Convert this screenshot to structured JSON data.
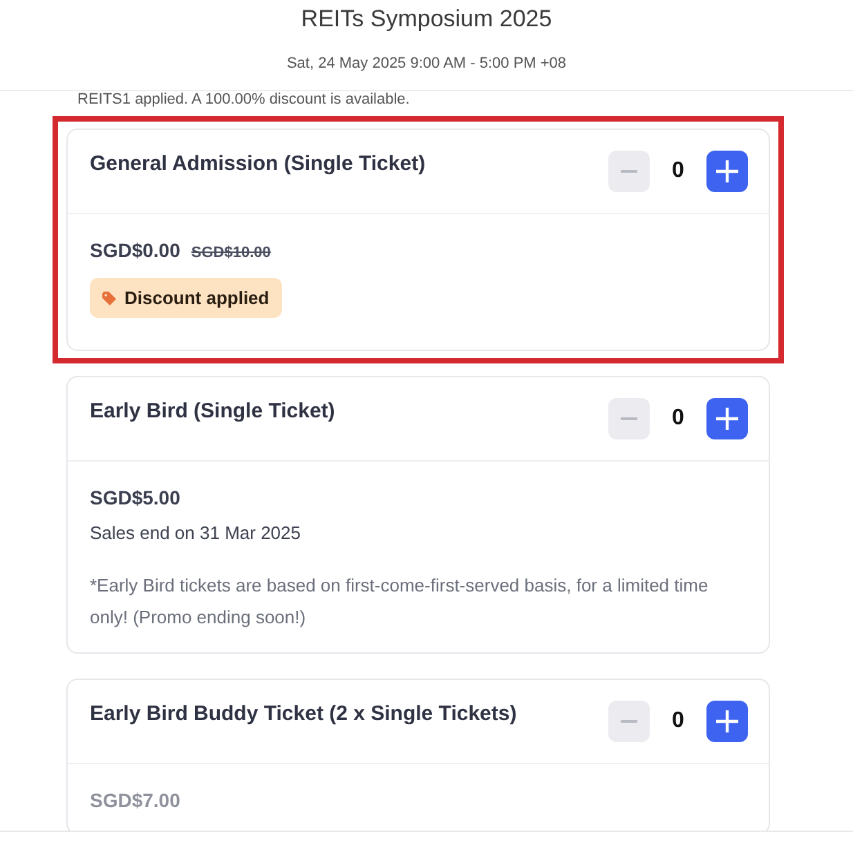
{
  "header": {
    "title": "REITs Symposium 2025",
    "datetime": "Sat, 24 May 2025 9:00 AM - 5:00 PM +08"
  },
  "promo_notice": "REITS1 applied. A 100.00% discount is available.",
  "tickets": [
    {
      "name": "General Admission (Single Ticket)",
      "highlighted": true,
      "minus_disabled": true,
      "quantity": "0",
      "price": "SGD$0.00",
      "original_price": "SGD$10.00",
      "muted": false,
      "badge": "Discount applied"
    },
    {
      "name": "Early Bird (Single Ticket)",
      "highlighted": false,
      "minus_disabled": true,
      "quantity": "0",
      "price": "SGD$5.00",
      "muted": false,
      "sales_end": "Sales end on 31 Mar 2025",
      "note": "*Early Bird tickets are based on first-come-first-served basis, for a limited time only! (Promo ending soon!)"
    },
    {
      "name": "Early Bird Buddy Ticket (2 x Single Tickets)",
      "highlighted": false,
      "minus_disabled": true,
      "quantity": "0",
      "price": "SGD$7.00",
      "muted": true
    }
  ]
}
